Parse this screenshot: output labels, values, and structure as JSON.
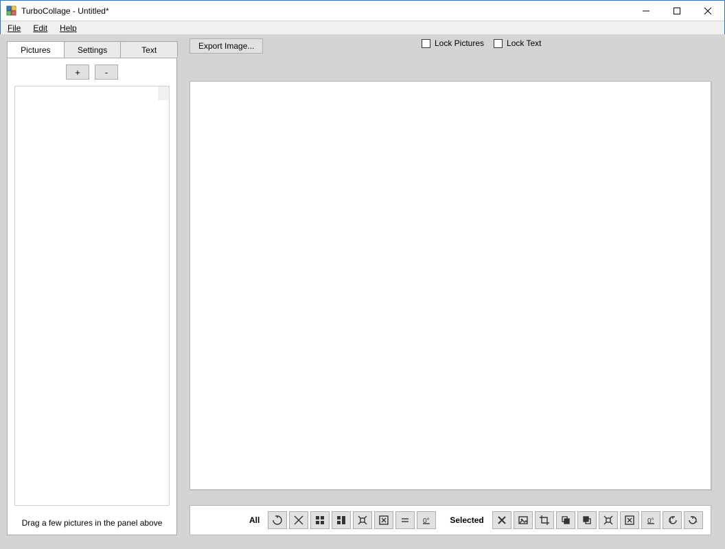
{
  "window": {
    "title": "TurboCollage - Untitled*"
  },
  "menu": {
    "file": "File",
    "edit": "Edit",
    "help": "Help"
  },
  "sidebar": {
    "tabs": {
      "pictures": "Pictures",
      "settings": "Settings",
      "text": "Text"
    },
    "add": "+",
    "remove": "-",
    "hint": "Drag a few pictures in the panel above"
  },
  "actions": {
    "export": "Export Image..."
  },
  "locks": {
    "lock_pictures": "Lock Pictures",
    "lock_text": "Lock Text",
    "lock_pictures_checked": false,
    "lock_text_checked": false
  },
  "bottombar": {
    "all_label": "All",
    "selected_label": "Selected"
  }
}
